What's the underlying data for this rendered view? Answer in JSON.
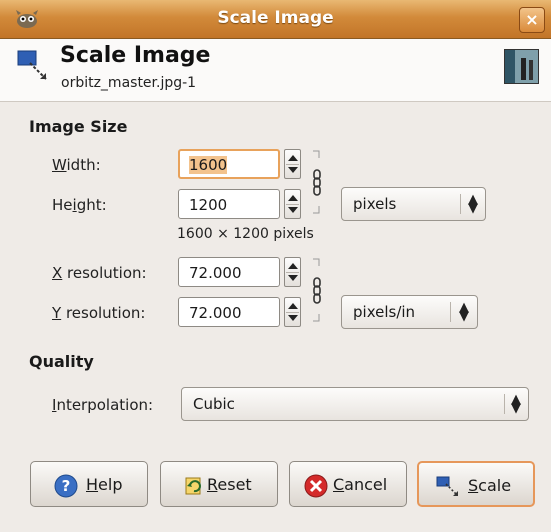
{
  "window": {
    "title": "Scale Image",
    "close_glyph": "×"
  },
  "header": {
    "title": "Scale Image",
    "subtitle": "orbitz_master.jpg-1"
  },
  "image_size": {
    "section_label": "Image Size",
    "width_label_pre": "",
    "width_label_u": "W",
    "width_label_post": "idth:",
    "width_value": "1600",
    "height_label_pre": "He",
    "height_label_u": "i",
    "height_label_post": "ght:",
    "height_value": "1200",
    "size_unit": "pixels",
    "dims_readout": "1600 × 1200 pixels",
    "xres_label_u": "X",
    "xres_label_post": " resolution:",
    "xres_value": "72.000",
    "yres_label_u": "Y",
    "yres_label_post": " resolution:",
    "yres_value": "72.000",
    "res_unit": "pixels/in"
  },
  "quality": {
    "section_label": "Quality",
    "interp_label_u": "I",
    "interp_label_post": "nterpolation:",
    "interp_value": "Cubic"
  },
  "buttons": {
    "help_u": "H",
    "help_post": "elp",
    "reset_u": "R",
    "reset_post": "eset",
    "cancel_u": "C",
    "cancel_post": "ancel",
    "scale_u": "S",
    "scale_post": "cale"
  },
  "colors": {
    "titlebar": "#d28a3a",
    "focus_border": "#e8a25b",
    "selection": "#f3c38d"
  }
}
